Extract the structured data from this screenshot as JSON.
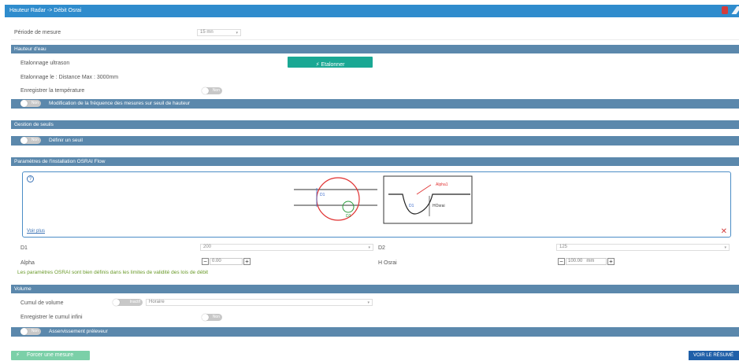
{
  "window": {
    "title": "Hauteur Radar -> Débit Osrai"
  },
  "periode": {
    "label": "Période de mesure",
    "value": "15 mn"
  },
  "hauteur": {
    "section": "Hauteur d'eau",
    "etalonnage_label": "Etalonnage ultrason",
    "etalonner_btn": "Etalonner",
    "etalonnage_info": "Etalonnage le : Distance Max : 3000mm",
    "temp_label": "Enregistrer la température",
    "temp_toggle": "Non",
    "freq_toggle": "Non",
    "freq_label": "Modification de la fréquence des mesures sur seuil de hauteur"
  },
  "seuils": {
    "section": "Gestion de seuils",
    "toggle": "Non",
    "label": "Définir un seuil"
  },
  "osra": {
    "section": "Paramètres de l'installation OSRAI Flow",
    "help_icon": "?",
    "voir_plus": "Voir plus",
    "diagram": {
      "d1": "D1",
      "d2": "D2",
      "d1b": "D1",
      "alpha": "Alpha1",
      "hosrai": "HOsrai"
    },
    "d1_label": "D1",
    "d1_value": "200",
    "d2_label": "D2",
    "d2_value": "125",
    "alpha_label": "Alpha",
    "alpha_value": "0.00",
    "hosrai_label": "H Osrai",
    "hosrai_value": "100.00",
    "hosrai_unit": "mm",
    "validation": "Les paramètres OSRAI sont bien définis dans les limites de validité des lois de débit"
  },
  "volume": {
    "section": "Volume",
    "cumul_label": "Cumul de volume",
    "cumul_toggle": "Inactif",
    "cumul_select": "Horaire",
    "cumul_infini_label": "Enregistrer le cumul infini",
    "cumul_infini_toggle": "Non",
    "asserv_toggle": "Non",
    "asserv_label": "Asservissement préleveur"
  },
  "footer": {
    "forcer": "Forcer une mesure",
    "voir_resume": "VOIR LE RÉSUMÉ"
  },
  "colors": {
    "header": "#2f8ccd",
    "section": "#5b88ac",
    "teal": "#1aa894",
    "green": "#6a9a2a",
    "red": "#d33c3c"
  }
}
